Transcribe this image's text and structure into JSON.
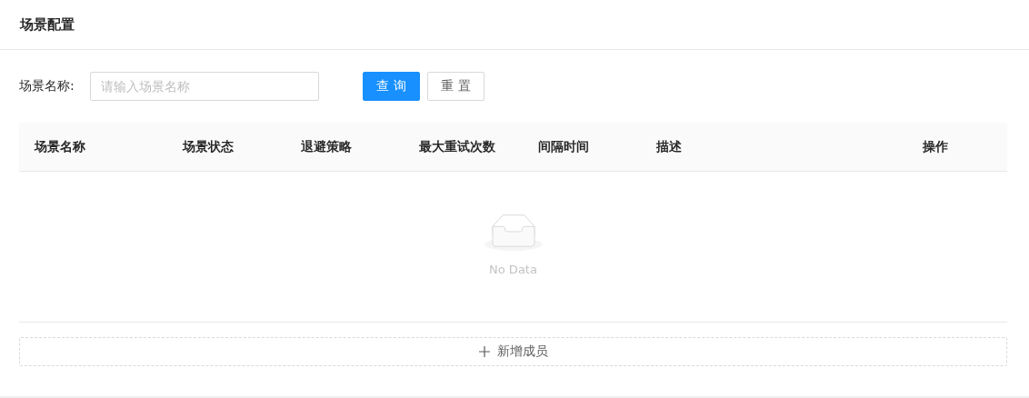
{
  "page_title": "场景配置",
  "search": {
    "label": "场景名称:",
    "placeholder": "请输入场景名称"
  },
  "buttons": [
    {
      "label": "查 询",
      "kind": "primary"
    },
    {
      "label": "重 置",
      "kind": "default"
    }
  ],
  "table": {
    "columns": [
      "场景名称",
      "场景状态",
      "退避策略",
      "最大重试次数",
      "间隔时间",
      "描述",
      "操作"
    ],
    "empty_text": "No Data"
  },
  "add_button": {
    "label": "新增成员"
  }
}
